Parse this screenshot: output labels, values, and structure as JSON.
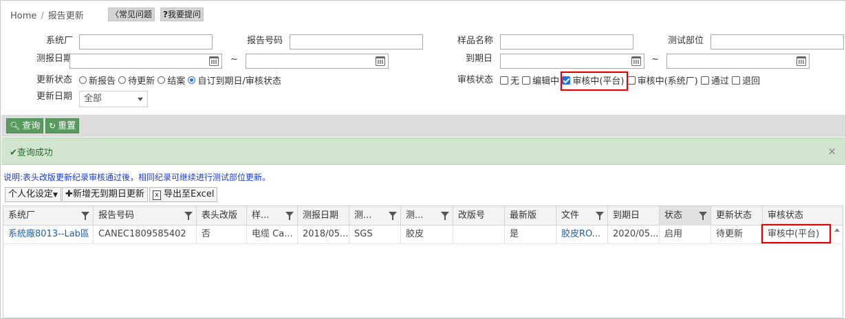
{
  "breadcrumb": {
    "home": "Home",
    "separator": "/",
    "current": "报告更新"
  },
  "help_buttons": {
    "faq": "常见问题",
    "ask": "我要提问"
  },
  "form": {
    "factory_label": "系统厂",
    "report_no_label": "报告号码",
    "sample_name_label": "样品名称",
    "test_part_label": "测试部位",
    "report_date_label": "测报日期",
    "due_date_label": "到期日",
    "tilde": "~",
    "update_status_label": "更新状态",
    "update_status_options": [
      "新报告",
      "待更新",
      "结案",
      "自订到期日/审核状态"
    ],
    "update_status_selected": "自订到期日/审核状态",
    "review_status_label": "审核状态",
    "review_status_options": [
      {
        "label": "无",
        "checked": false
      },
      {
        "label": "编辑中",
        "checked": false
      },
      {
        "label": "审核中(平台)",
        "checked": true
      },
      {
        "label": "审核中(系统厂)",
        "checked": false
      },
      {
        "label": "通过",
        "checked": false
      },
      {
        "label": "退回",
        "checked": false
      }
    ],
    "update_date_label": "更新日期",
    "update_date_value": "全部"
  },
  "toolbar": {
    "query": "查询",
    "reset": "重置"
  },
  "alert": {
    "message": "查询成功",
    "close": "×"
  },
  "note": "说明:表头改版更新纪录审核通过後，相同纪录可继续进行测试部位更新。",
  "grid_toolbar": {
    "personalize": "个人化设定",
    "add_new": "新增无到期日更新",
    "export": "导出至Excel"
  },
  "grid": {
    "columns": [
      "系统厂",
      "报告号码",
      "表头改版",
      "样...",
      "测报日期",
      "测...",
      "测...",
      "改版号",
      "最新版",
      "文件",
      "到期日",
      "状态",
      "更新状态",
      "审核状态"
    ],
    "rows": [
      [
        "系統廠8013--Lab區",
        "CANEC1809585402",
        "否",
        "电缆 Ca...",
        "2018/05...",
        "SGS",
        "胶皮",
        "",
        "是",
        "胶皮RO...",
        "2020/05...",
        "启用",
        "待更新",
        "审核中(平台)"
      ]
    ]
  },
  "colors": {
    "accent_green": "#5a9a60",
    "highlight_red": "#e00000",
    "link_blue": "#1c5fa8",
    "note_blue": "#1a3bd6"
  }
}
